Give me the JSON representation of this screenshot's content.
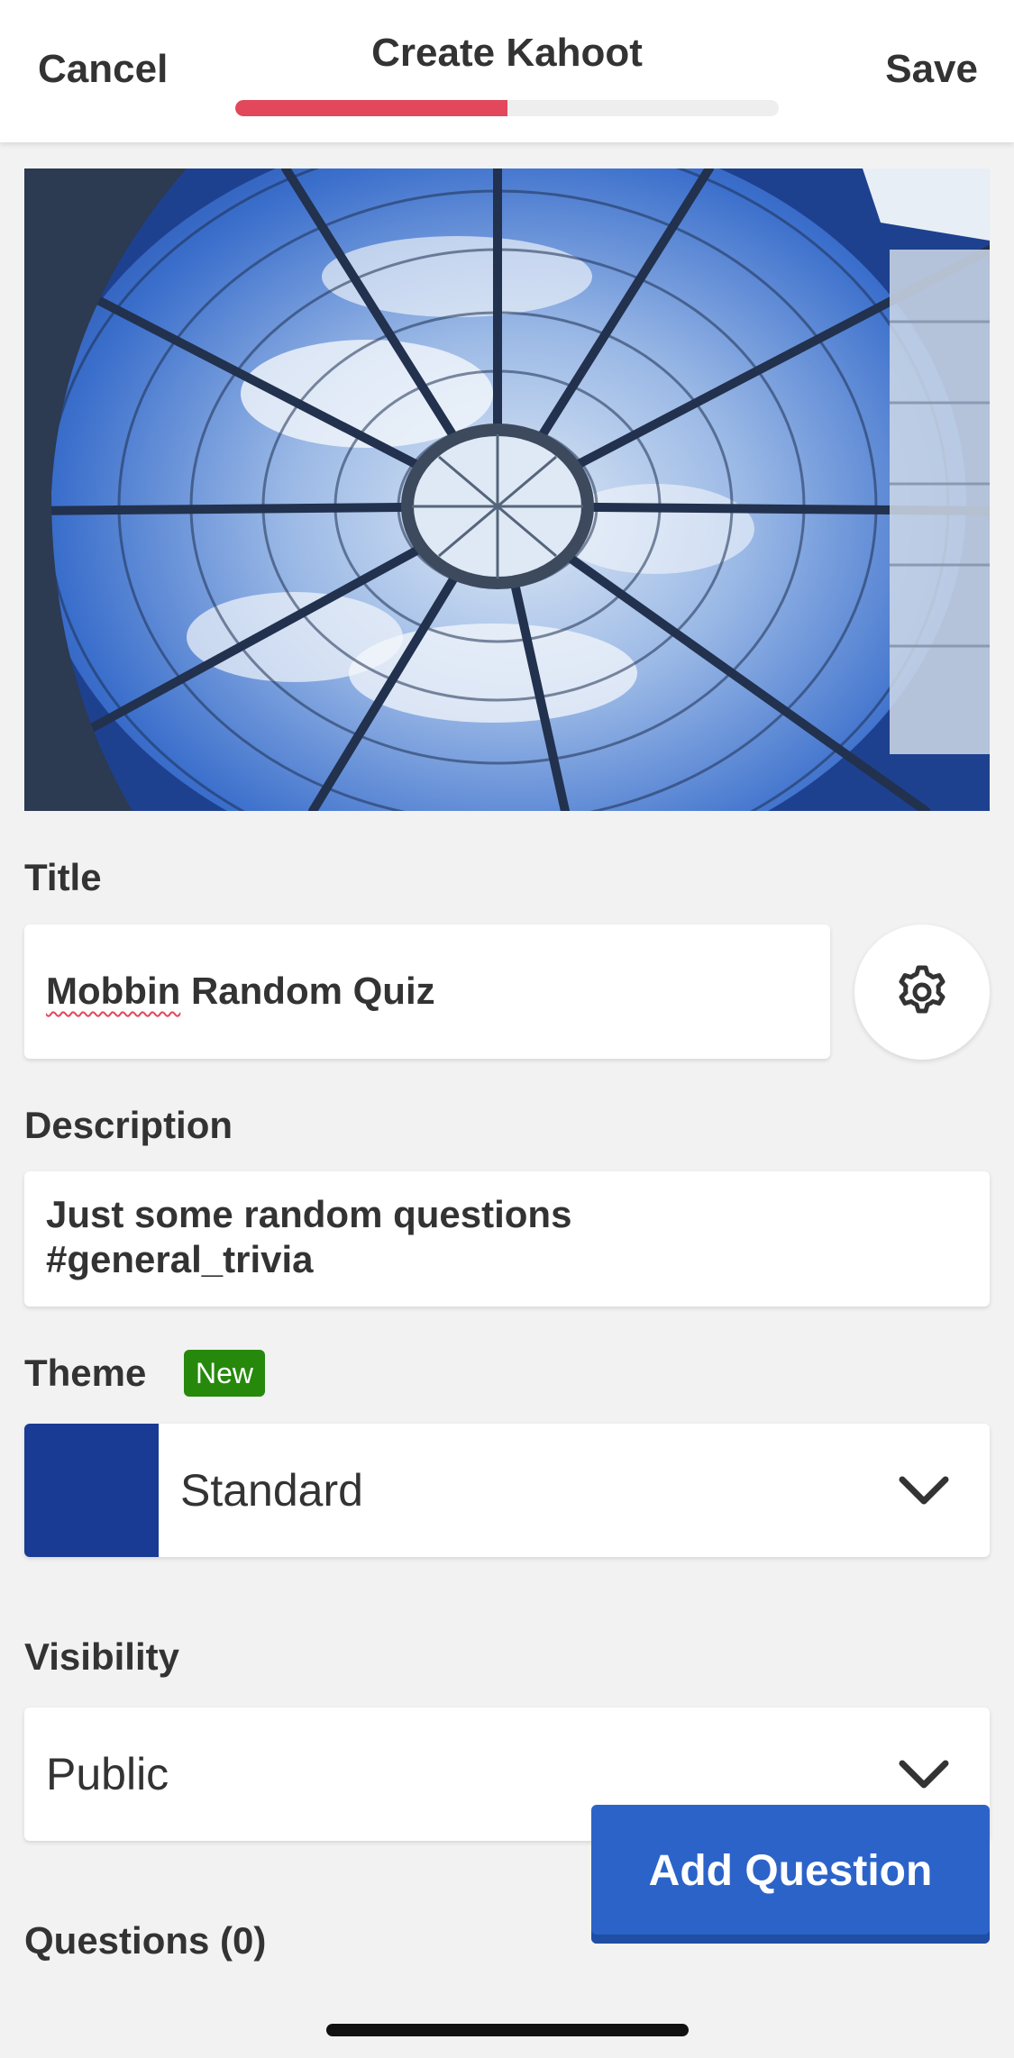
{
  "header": {
    "cancel_label": "Cancel",
    "title": "Create Kahoot",
    "save_label": "Save",
    "progress": 0.5
  },
  "cover_image": {
    "edit_icon": "pencil-icon",
    "remove_icon": "close-icon"
  },
  "title_field": {
    "label": "Title",
    "value_misspelled": "Mobbin",
    "value_rest": " Random Quiz",
    "settings_icon": "gear-icon"
  },
  "description_field": {
    "label": "Description",
    "line1": "Just some random questions",
    "line2": "#general_trivia"
  },
  "theme": {
    "label": "Theme",
    "badge": "New",
    "selected": "Standard",
    "swatch_color": "#1a3b94"
  },
  "visibility": {
    "label": "Visibility",
    "selected": "Public"
  },
  "questions": {
    "label": "Questions (0)",
    "add_button": "Add Question"
  },
  "colors": {
    "accent_red": "#e2475b",
    "primary_blue": "#2c63c9",
    "badge_green": "#26890c"
  }
}
